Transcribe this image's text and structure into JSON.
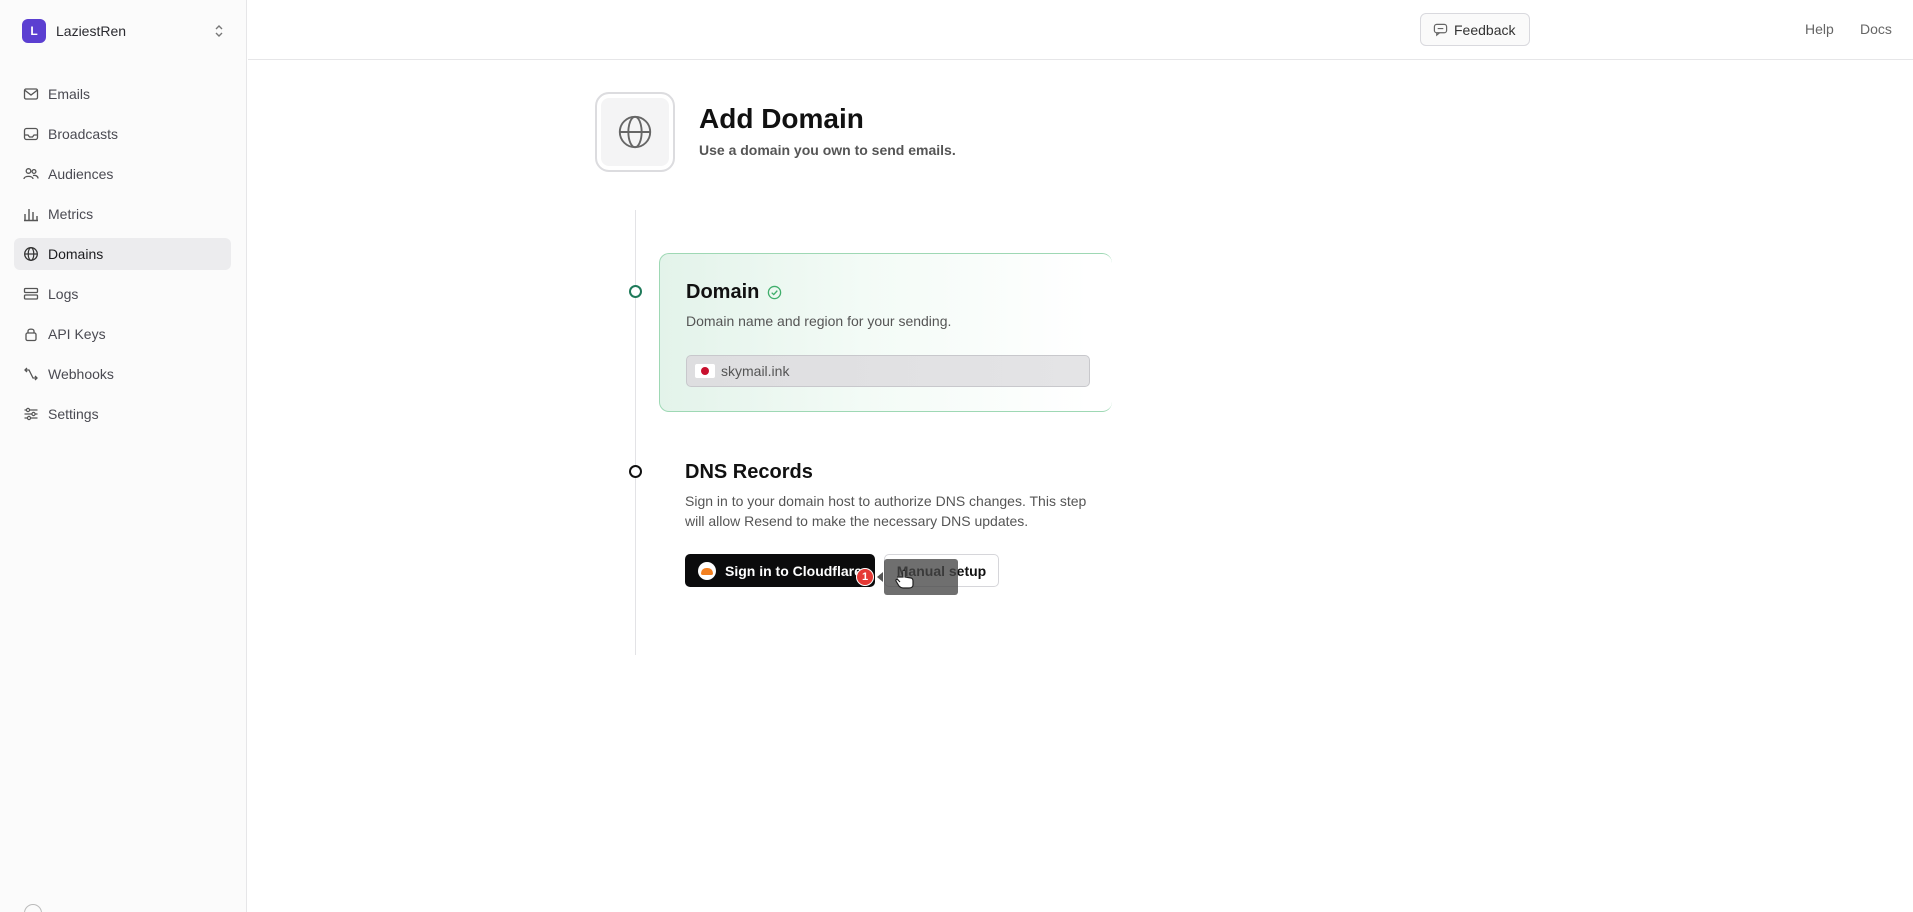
{
  "workspace": {
    "initial": "L",
    "name": "LaziestRen"
  },
  "nav": {
    "items": [
      {
        "label": "Emails",
        "icon": "mail-icon"
      },
      {
        "label": "Broadcasts",
        "icon": "inbox-icon"
      },
      {
        "label": "Audiences",
        "icon": "users-icon"
      },
      {
        "label": "Metrics",
        "icon": "bar-chart-icon"
      },
      {
        "label": "Domains",
        "icon": "globe-icon",
        "active": true
      },
      {
        "label": "Logs",
        "icon": "logs-icon"
      },
      {
        "label": "API Keys",
        "icon": "lock-icon"
      },
      {
        "label": "Webhooks",
        "icon": "webhook-icon"
      },
      {
        "label": "Settings",
        "icon": "sliders-icon"
      }
    ]
  },
  "topbar": {
    "feedback_label": "Feedback",
    "help_label": "Help",
    "docs_label": "Docs"
  },
  "header": {
    "title": "Add Domain",
    "subtitle": "Use a domain you own to send emails."
  },
  "domain_step": {
    "title": "Domain",
    "description": "Domain name and region for your sending.",
    "value": "skymail.ink",
    "status": "complete"
  },
  "dns_step": {
    "title": "DNS Records",
    "description": "Sign in to your domain host to authorize DNS changes. This step will allow Resend to make the necessary DNS updates.",
    "cloudflare_button": "Sign in to Cloudflare",
    "manual_button": "Manual setup"
  },
  "overlay": {
    "badge_count": "1"
  },
  "colors": {
    "accent": "#5b3fd1",
    "success": "#1f7a5a",
    "success_card_border": "#9ed8b4",
    "cloudflare_orange": "#f38020",
    "badge_red": "#e53935"
  }
}
